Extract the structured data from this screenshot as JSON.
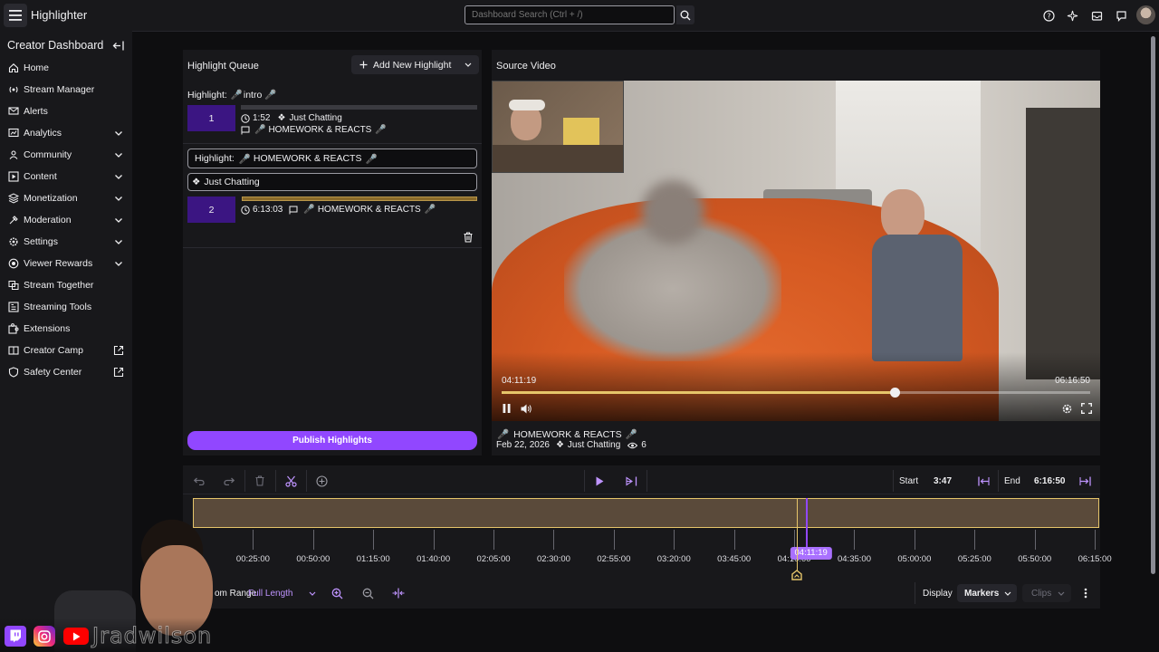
{
  "app": {
    "title": "Highlighter"
  },
  "topbar": {
    "search_placeholder": "Dashboard Search (Ctrl + /)"
  },
  "sidebar": {
    "title": "Creator Dashboard",
    "items": [
      {
        "label": "Home",
        "icon": "home-icon",
        "expand": "none"
      },
      {
        "label": "Stream Manager",
        "icon": "stream-manager-icon",
        "expand": "none"
      },
      {
        "label": "Alerts",
        "icon": "alerts-icon",
        "expand": "none"
      },
      {
        "label": "Analytics",
        "icon": "analytics-icon",
        "expand": "chevron"
      },
      {
        "label": "Community",
        "icon": "community-icon",
        "expand": "chevron"
      },
      {
        "label": "Content",
        "icon": "content-icon",
        "expand": "chevron"
      },
      {
        "label": "Monetization",
        "icon": "monetization-icon",
        "expand": "chevron"
      },
      {
        "label": "Moderation",
        "icon": "moderation-icon",
        "expand": "chevron"
      },
      {
        "label": "Settings",
        "icon": "settings-icon",
        "expand": "chevron"
      },
      {
        "label": "Viewer Rewards",
        "icon": "viewer-rewards-icon",
        "expand": "chevron"
      },
      {
        "label": "Stream Together",
        "icon": "stream-together-icon",
        "expand": "none"
      },
      {
        "label": "Streaming Tools",
        "icon": "streaming-tools-icon",
        "expand": "none"
      },
      {
        "label": "Extensions",
        "icon": "extensions-icon",
        "expand": "none"
      },
      {
        "label": "Creator Camp",
        "icon": "creator-camp-icon",
        "expand": "external"
      },
      {
        "label": "Safety Center",
        "icon": "safety-center-icon",
        "expand": "external"
      }
    ]
  },
  "queue": {
    "title": "Highlight Queue",
    "add_label": "Add New Highlight",
    "items": [
      {
        "prefix": "Highlight:",
        "name": "intro",
        "number": "1",
        "duration": "1:52",
        "category": "Just Chatting",
        "stream_title": "HOMEWORK & REACTS",
        "progress": 0
      },
      {
        "prefix": "Highlight:",
        "name": "HOMEWORK & REACTS",
        "category": "Just Chatting",
        "number": "2",
        "duration": "6:13:03",
        "stream_title": "HOMEWORK & REACTS",
        "progress": 1.0
      }
    ],
    "publish_label": "Publish Highlights"
  },
  "source_video": {
    "title": "Source Video",
    "current_time": "04:11:19",
    "total_time": "06:16:50",
    "progress": 0.667,
    "stream_title": "HOMEWORK & REACTS",
    "date": "Feb 22, 2026",
    "category": "Just Chatting",
    "views": "6"
  },
  "timeline": {
    "start_label": "Start",
    "start_value": "3:47",
    "end_label": "End",
    "end_value": "6:16:50",
    "playhead_time": "04:11:19",
    "playhead_fraction": 0.667,
    "ticks": [
      "00:25:00",
      "00:50:00",
      "01:15:00",
      "01:40:00",
      "02:05:00",
      "02:30:00",
      "02:55:00",
      "03:20:00",
      "03:45:00",
      "04:10:00",
      "04:35:00",
      "05:00:00",
      "05:25:00",
      "05:50:00",
      "06:15:00"
    ],
    "zoom_label": "om Range",
    "zoom_value": "Full Length",
    "display_label": "Display",
    "markers_label": "Markers",
    "clips_label": "Clips"
  },
  "overlay": {
    "watermark": "Jradwilson"
  },
  "colors": {
    "accent": "#9147ff",
    "timeline_fill": "#5a4a3a",
    "timeline_border": "#e6c56a",
    "queue_num": "#3b1582"
  }
}
